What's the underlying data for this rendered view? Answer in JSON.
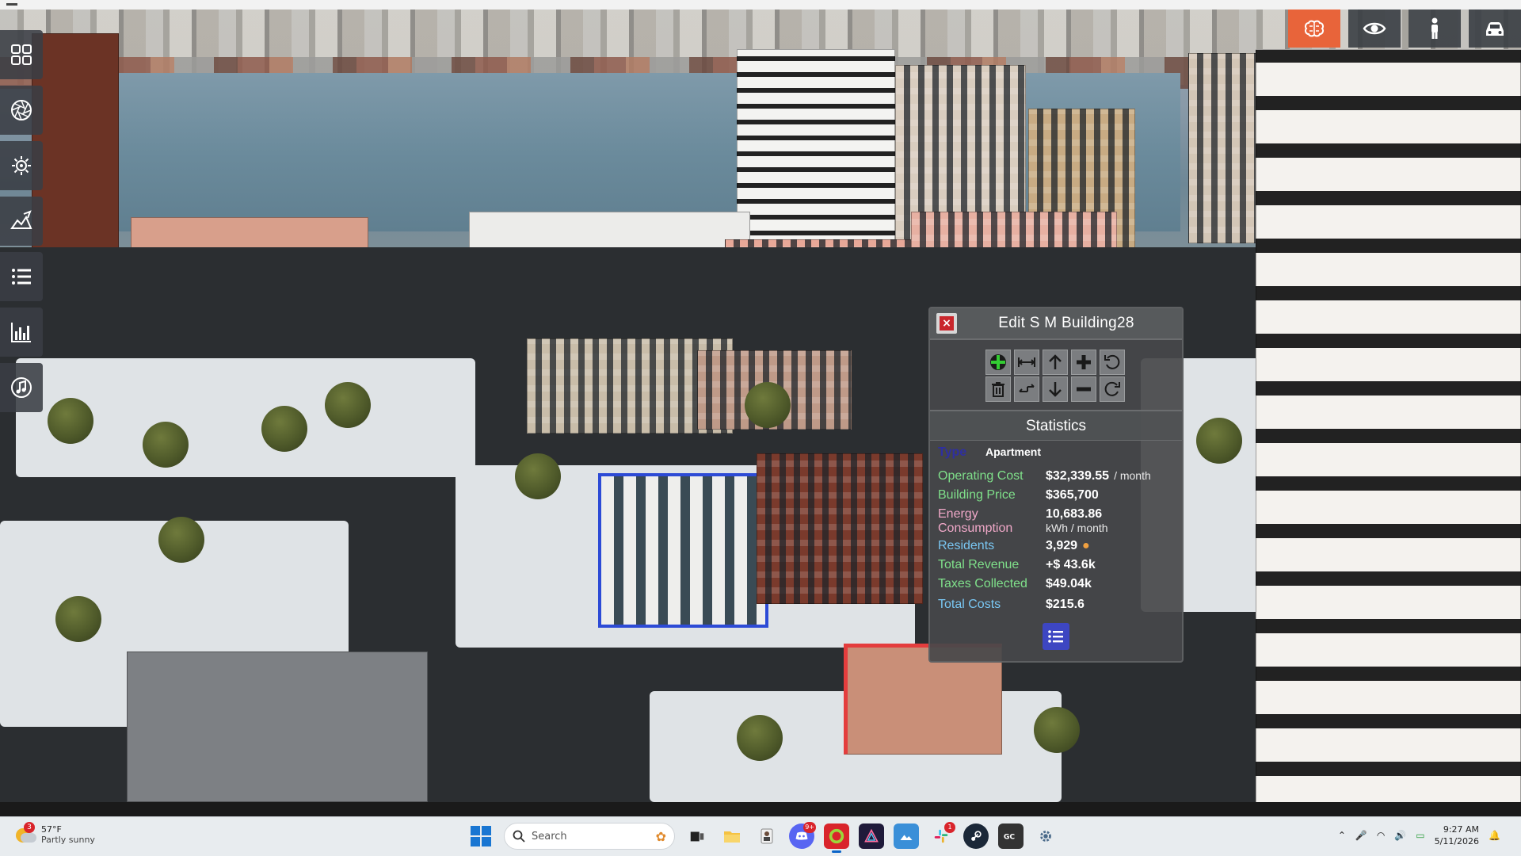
{
  "colors": {
    "accent_active": "#e8643a",
    "panel_bg": "#46484a",
    "operating_cost": "#7fe08a",
    "energy": "#f0a8c8",
    "residents": "#79c6f2",
    "type_label": "#2f2fa0",
    "list_button": "#3d46c2",
    "close_red": "#c9262c",
    "selection_outline": "#2d4bd6"
  },
  "left_toolbar": {
    "items": [
      {
        "name": "grid-icon"
      },
      {
        "name": "aperture-icon"
      },
      {
        "name": "sun-settings-icon"
      },
      {
        "name": "terrain-brush-icon"
      },
      {
        "name": "list-icon"
      },
      {
        "name": "stats-chart-icon"
      },
      {
        "name": "music-icon"
      }
    ]
  },
  "view_toolbar": {
    "items": [
      {
        "name": "brain-icon",
        "active": true
      },
      {
        "name": "eye-icon",
        "active": false
      },
      {
        "name": "person-icon",
        "active": false
      },
      {
        "name": "car-icon",
        "active": false
      }
    ]
  },
  "edit_panel": {
    "title": "Edit S M Building28",
    "close_symbol": "×",
    "tools_row1": [
      "move-icon",
      "width-icon",
      "arrow-up-icon",
      "plus-icon",
      "rotate-left-icon"
    ],
    "tools_row2": [
      "delete-icon",
      "swap-icon",
      "arrow-down-icon",
      "minus-icon",
      "rotate-right-icon"
    ],
    "statistics_label": "Statistics",
    "type_label": "Type",
    "type_value": "Apartment",
    "operating_cost_label": "Operating Cost",
    "operating_cost_value": "$32,339.55",
    "operating_cost_unit": "/ month",
    "building_price_label": "Building Price",
    "building_price_value": "$365,700",
    "energy_label_1": "Energy",
    "energy_label_2": "Consumption",
    "energy_value": "10,683.86",
    "energy_unit": "kWh / month",
    "residents_label": "Residents",
    "residents_value": "3,929",
    "total_revenue_label": "Total Revenue",
    "total_revenue_value": "+$ 43.6k",
    "taxes_label": "Taxes Collected",
    "taxes_value": "$49.04k",
    "total_costs_label": "Total Costs",
    "total_costs_value": "$215.6"
  },
  "taskbar": {
    "weather_badge": "3",
    "temperature": "57°F",
    "condition": "Partly sunny",
    "search_placeholder": "Search",
    "discord_badge": "9+",
    "slack_badge": "1",
    "time": "9:27 AM",
    "date": "5/11/2026"
  }
}
